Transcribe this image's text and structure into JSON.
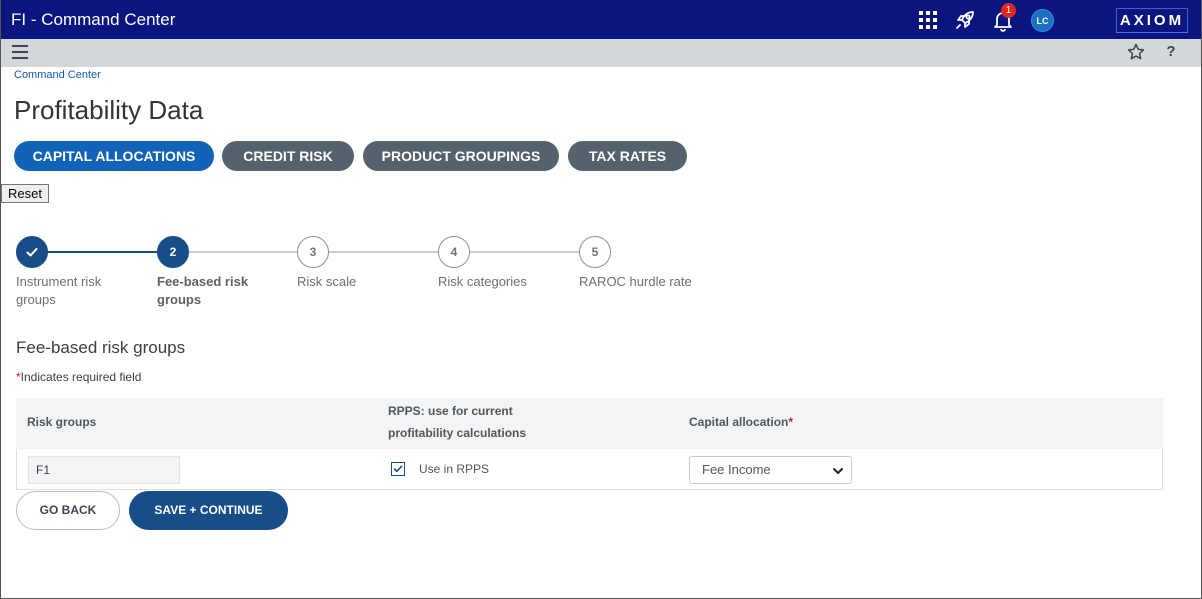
{
  "header": {
    "app_title": "FI - Command Center",
    "notification_count": "1",
    "user_initials": "LC",
    "logo_text": "AXIOM",
    "colors": {
      "topbar": "#0a1580",
      "subbar": "#d4d7da",
      "badge": "#e0281f",
      "avatar": "#1b6fc0"
    }
  },
  "toolbar": {
    "menu_icon": "hamburger-menu-icon",
    "star_icon": "star-icon",
    "help_label": "?"
  },
  "breadcrumb": "Command Center",
  "page_title": "Profitability Data",
  "tabs": [
    {
      "label": "CAPITAL ALLOCATIONS",
      "active": true
    },
    {
      "label": "CREDIT RISK",
      "active": false
    },
    {
      "label": "PRODUCT GROUPINGS",
      "active": false
    },
    {
      "label": "TAX RATES",
      "active": false
    }
  ],
  "reset_label": "Reset",
  "stepper": {
    "steps": [
      {
        "number": "1",
        "state": "done",
        "label": "Instrument risk groups"
      },
      {
        "number": "2",
        "state": "current",
        "label": "Fee-based risk groups"
      },
      {
        "number": "3",
        "state": "todo",
        "label": "Risk scale"
      },
      {
        "number": "4",
        "state": "todo",
        "label": "Risk categories"
      },
      {
        "number": "5",
        "state": "todo",
        "label": "RAROC hurdle rate"
      }
    ],
    "colors": {
      "complete": "#174e8a",
      "incomplete": "#c9cdd2"
    }
  },
  "form": {
    "section_title": "Fee-based risk groups",
    "required_star": "*",
    "required_note": "Indicates required field",
    "columns": {
      "risk_groups": "Risk groups",
      "rpps": "RPPS: use for current profitability calculations",
      "capital_allocation": "Capital allocation",
      "capital_allocation_required": "*"
    },
    "rows": [
      {
        "risk_group": "F1",
        "use_in_rpps_checked": true,
        "use_in_rpps_label": "Use in RPPS",
        "capital_allocation": "Fee Income"
      }
    ]
  },
  "actions": {
    "go_back": "GO BACK",
    "save_continue": "SAVE + CONTINUE"
  }
}
